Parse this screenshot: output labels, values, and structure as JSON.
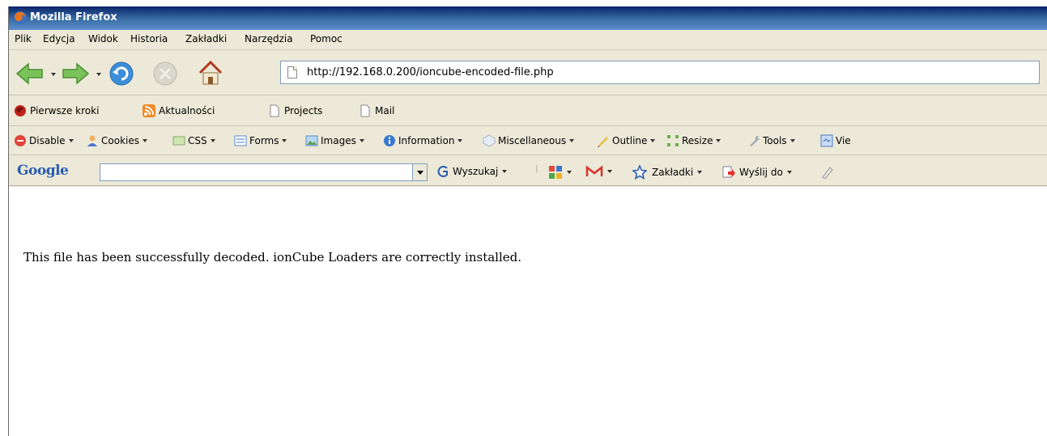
{
  "window": {
    "title": "Mozilla Firefox"
  },
  "menu": [
    "Plik",
    "Edycja",
    "Widok",
    "Historia",
    "Zakładki",
    "Narzędzia",
    "Pomoc"
  ],
  "address": {
    "url": "http://192.168.0.200/ioncube-encoded-file.php"
  },
  "bookmarks": [
    "Pierwsze kroki",
    "Aktualności",
    "Projects",
    "Mail"
  ],
  "devtoolbar": [
    "Disable",
    "Cookies",
    "CSS",
    "Forms",
    "Images",
    "Information",
    "Miscellaneous",
    "Outline",
    "Resize",
    "Tools",
    "Vie"
  ],
  "googlebar": {
    "logo": "Google",
    "search_value": "",
    "search_button": "Wyszukaj",
    "bookmarks": "Zakładki",
    "send_to": "Wyślij do"
  },
  "page": {
    "message": "This file has been successfully decoded. ionCube Loaders are correctly installed."
  },
  "colors": {
    "titlebar": "#0a246a",
    "chrome": "#ece9d8",
    "google_blue": "#2a5db0"
  }
}
